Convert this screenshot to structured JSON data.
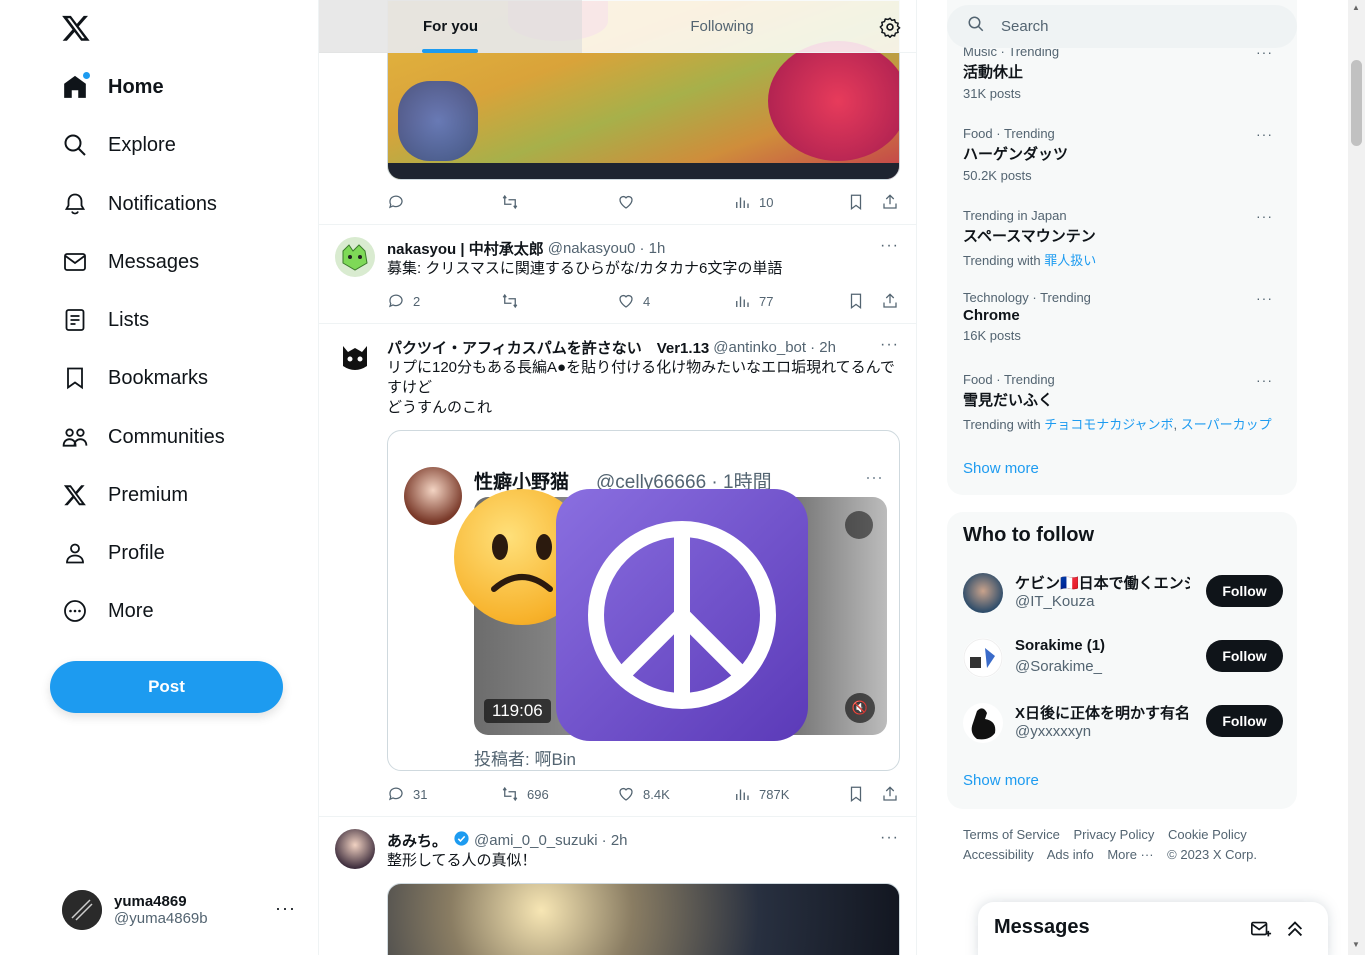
{
  "nav": {
    "items": [
      {
        "label": "Home"
      },
      {
        "label": "Explore"
      },
      {
        "label": "Notifications"
      },
      {
        "label": "Messages"
      },
      {
        "label": "Lists"
      },
      {
        "label": "Bookmarks"
      },
      {
        "label": "Communities"
      },
      {
        "label": "Premium"
      },
      {
        "label": "Profile"
      },
      {
        "label": "More"
      }
    ],
    "post_label": "Post",
    "account": {
      "name": "yuma4869",
      "handle": "@yuma4869b"
    }
  },
  "tabs": {
    "for_you": "For you",
    "following": "Following"
  },
  "tweets": [
    {
      "stats": {
        "views": "10"
      }
    },
    {
      "name": "nakasyou | 中村承太郎",
      "handle": "@nakasyou0",
      "time": "· 1h",
      "text": "募集: クリスマスに関連するひらがな/カタカナ6文字の単語",
      "stats": {
        "replies": "2",
        "likes": "4",
        "views": "77"
      }
    },
    {
      "name": "パクツイ・アフィカスパムを許さない　Ver1.13",
      "handle": "@antinko_bot",
      "time": "· 2h",
      "text1": "リプに120分もある長編A●を貼り付ける化け物みたいなエロ垢現れてるんで",
      "text2": "すけど",
      "text3": "どうすんのこれ",
      "quote": {
        "name": "性癖小野猫",
        "handle": "@celly66666 · 1時間",
        "duration": "119:06",
        "footer": "投稿者: 啊Bin"
      },
      "stats": {
        "replies": "31",
        "retweets": "696",
        "likes": "8.4K",
        "views": "787K"
      }
    },
    {
      "name": "あみち。",
      "handle": "@ami_0_0_suzuki",
      "time": "· 2h",
      "text": "整形してる人の真似！"
    }
  ],
  "search": {
    "placeholder": "Search"
  },
  "trends": [
    {
      "category": "Music · Trending",
      "title": "活動休止",
      "count": "31K posts"
    },
    {
      "category": "Food · Trending",
      "title": "ハーゲンダッツ",
      "count": "50.2K posts"
    },
    {
      "category": "Trending in Japan",
      "title": "スペースマウンテン",
      "with_label": "Trending with",
      "with_links": [
        "罪人扱い"
      ]
    },
    {
      "category": "Technology · Trending",
      "title": "Chrome",
      "count": "16K posts"
    },
    {
      "category": "Food · Trending",
      "title": "雪見だいふく",
      "with_label": "Trending with",
      "with_links": [
        "チョコモナカジャンボ",
        "スーパーカップ"
      ]
    }
  ],
  "show_more": "Show more",
  "who_to_follow": {
    "title": "Who to follow",
    "users": [
      {
        "name": "ケビン🇫🇷日本で働くエンジニア",
        "handle": "@IT_Kouza",
        "button": "Follow"
      },
      {
        "name": "Sorakime (1)",
        "handle": "@Sorakime_",
        "button": "Follow"
      },
      {
        "name": "X日後に正体を明かす有名人",
        "handle": "@yxxxxxyn",
        "button": "Follow"
      }
    ],
    "show_more": "Show more"
  },
  "footer": {
    "links": [
      "Terms of Service",
      "Privacy Policy",
      "Cookie Policy",
      "Accessibility",
      "Ads info",
      "More ···",
      "© 2023 X Corp."
    ]
  },
  "messages_dock": {
    "title": "Messages"
  },
  "colors": {
    "accent": "#1d9bf0",
    "text": "#0f1419",
    "muted": "#536471"
  }
}
